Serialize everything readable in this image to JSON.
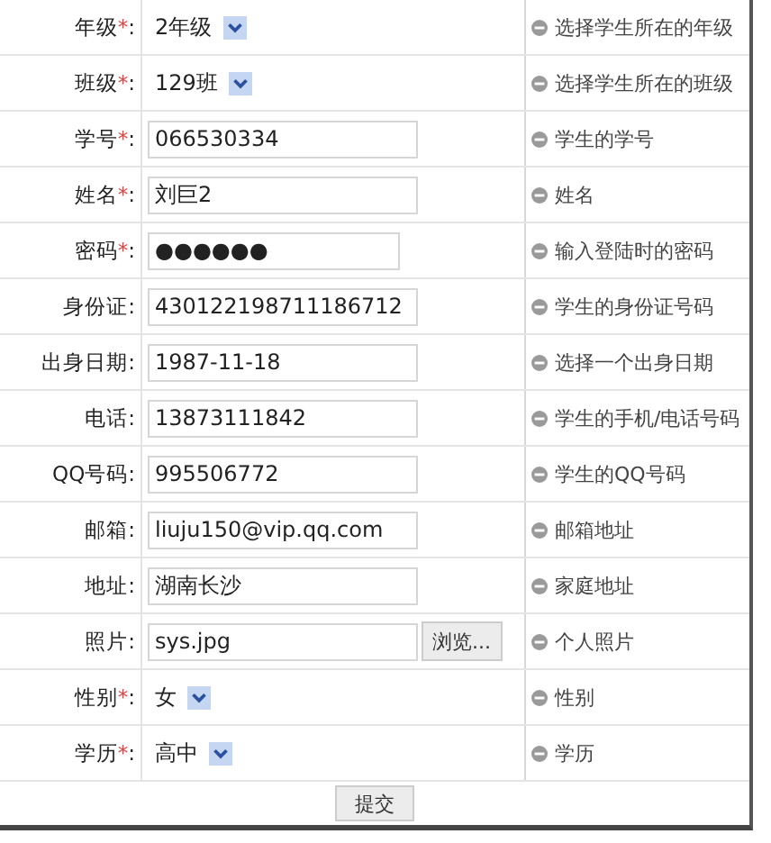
{
  "fields": [
    {
      "label": "年级",
      "required_mark": "*",
      "colon": ":",
      "kind": "select",
      "value": "2年级",
      "hint": "选择学生所在的年级"
    },
    {
      "label": "班级",
      "required_mark": "*",
      "colon": ":",
      "kind": "select",
      "value": "129班",
      "hint": "选择学生所在的班级"
    },
    {
      "label": "学号",
      "required_mark": "*",
      "colon": ":",
      "kind": "text",
      "value": "066530334",
      "hint": "学生的学号"
    },
    {
      "label": "姓名",
      "required_mark": "*",
      "colon": ":",
      "kind": "text",
      "value": "刘巨2",
      "hint": "姓名"
    },
    {
      "label": "密码",
      "required_mark": "*",
      "colon": ":",
      "kind": "password",
      "value": "●●●●●●",
      "hint": "输入登陆时的密码"
    },
    {
      "label": "身份证",
      "colon": ":",
      "kind": "text",
      "value": "430122198711186712",
      "hint": "学生的身份证号码"
    },
    {
      "label": "出身日期",
      "colon": ":",
      "kind": "text",
      "value": "1987-11-18",
      "hint": "选择一个出身日期"
    },
    {
      "label": "电话",
      "colon": ":",
      "kind": "text",
      "value": "13873111842",
      "hint": "学生的手机/电话号码"
    },
    {
      "label": "QQ号码",
      "colon": ":",
      "kind": "text",
      "value": "995506772",
      "hint": "学生的QQ号码"
    },
    {
      "label": "邮箱",
      "colon": ":",
      "kind": "text",
      "value": "liuju150@vip.qq.com",
      "hint": "邮箱地址"
    },
    {
      "label": "地址",
      "colon": ":",
      "kind": "text",
      "value": "湖南长沙",
      "hint": "家庭地址"
    },
    {
      "label": "照片",
      "colon": ":",
      "kind": "file",
      "value": "sys.jpg",
      "button": "浏览...",
      "hint": "个人照片"
    },
    {
      "label": "性别",
      "required_mark": "*",
      "colon": ":",
      "kind": "select",
      "value": "女",
      "hint": "性别"
    },
    {
      "label": "学历",
      "required_mark": "*",
      "colon": ":",
      "kind": "select",
      "value": "高中",
      "hint": "学历"
    }
  ],
  "submit": "提交"
}
